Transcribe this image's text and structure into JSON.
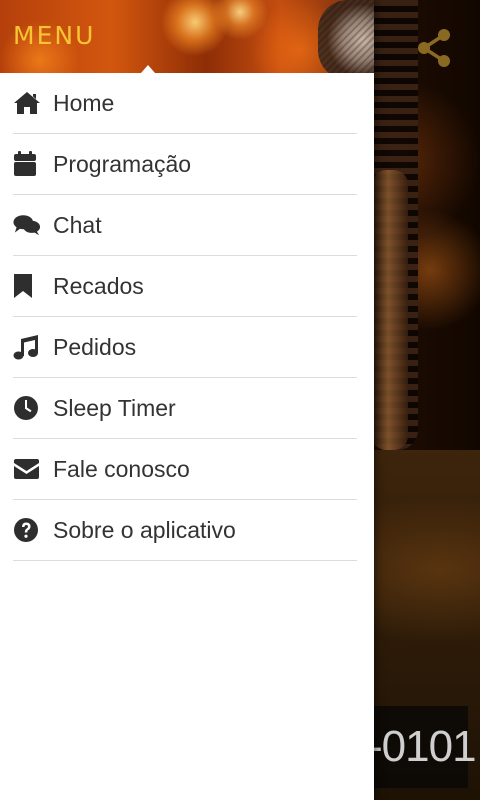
{
  "drawer": {
    "title": "MENU",
    "items": [
      {
        "label": "Home",
        "icon": "home-icon"
      },
      {
        "label": "Programação",
        "icon": "calendar-icon"
      },
      {
        "label": "Chat",
        "icon": "chat-bubbles-icon"
      },
      {
        "label": "Recados",
        "icon": "bookmark-icon"
      },
      {
        "label": "Pedidos",
        "icon": "music-note-icon"
      },
      {
        "label": "Sleep Timer",
        "icon": "clock-icon"
      },
      {
        "label": "Fale conosco",
        "icon": "envelope-icon"
      },
      {
        "label": "Sobre o aplicativo",
        "icon": "question-circle-icon"
      }
    ]
  },
  "background": {
    "share_icon": "share-icon",
    "phone_fragment": "-0101"
  },
  "colors": {
    "title": "#f7c433",
    "share_icon": "#8a6a22",
    "menu_text": "#333333",
    "divider": "#dcdcdc"
  }
}
